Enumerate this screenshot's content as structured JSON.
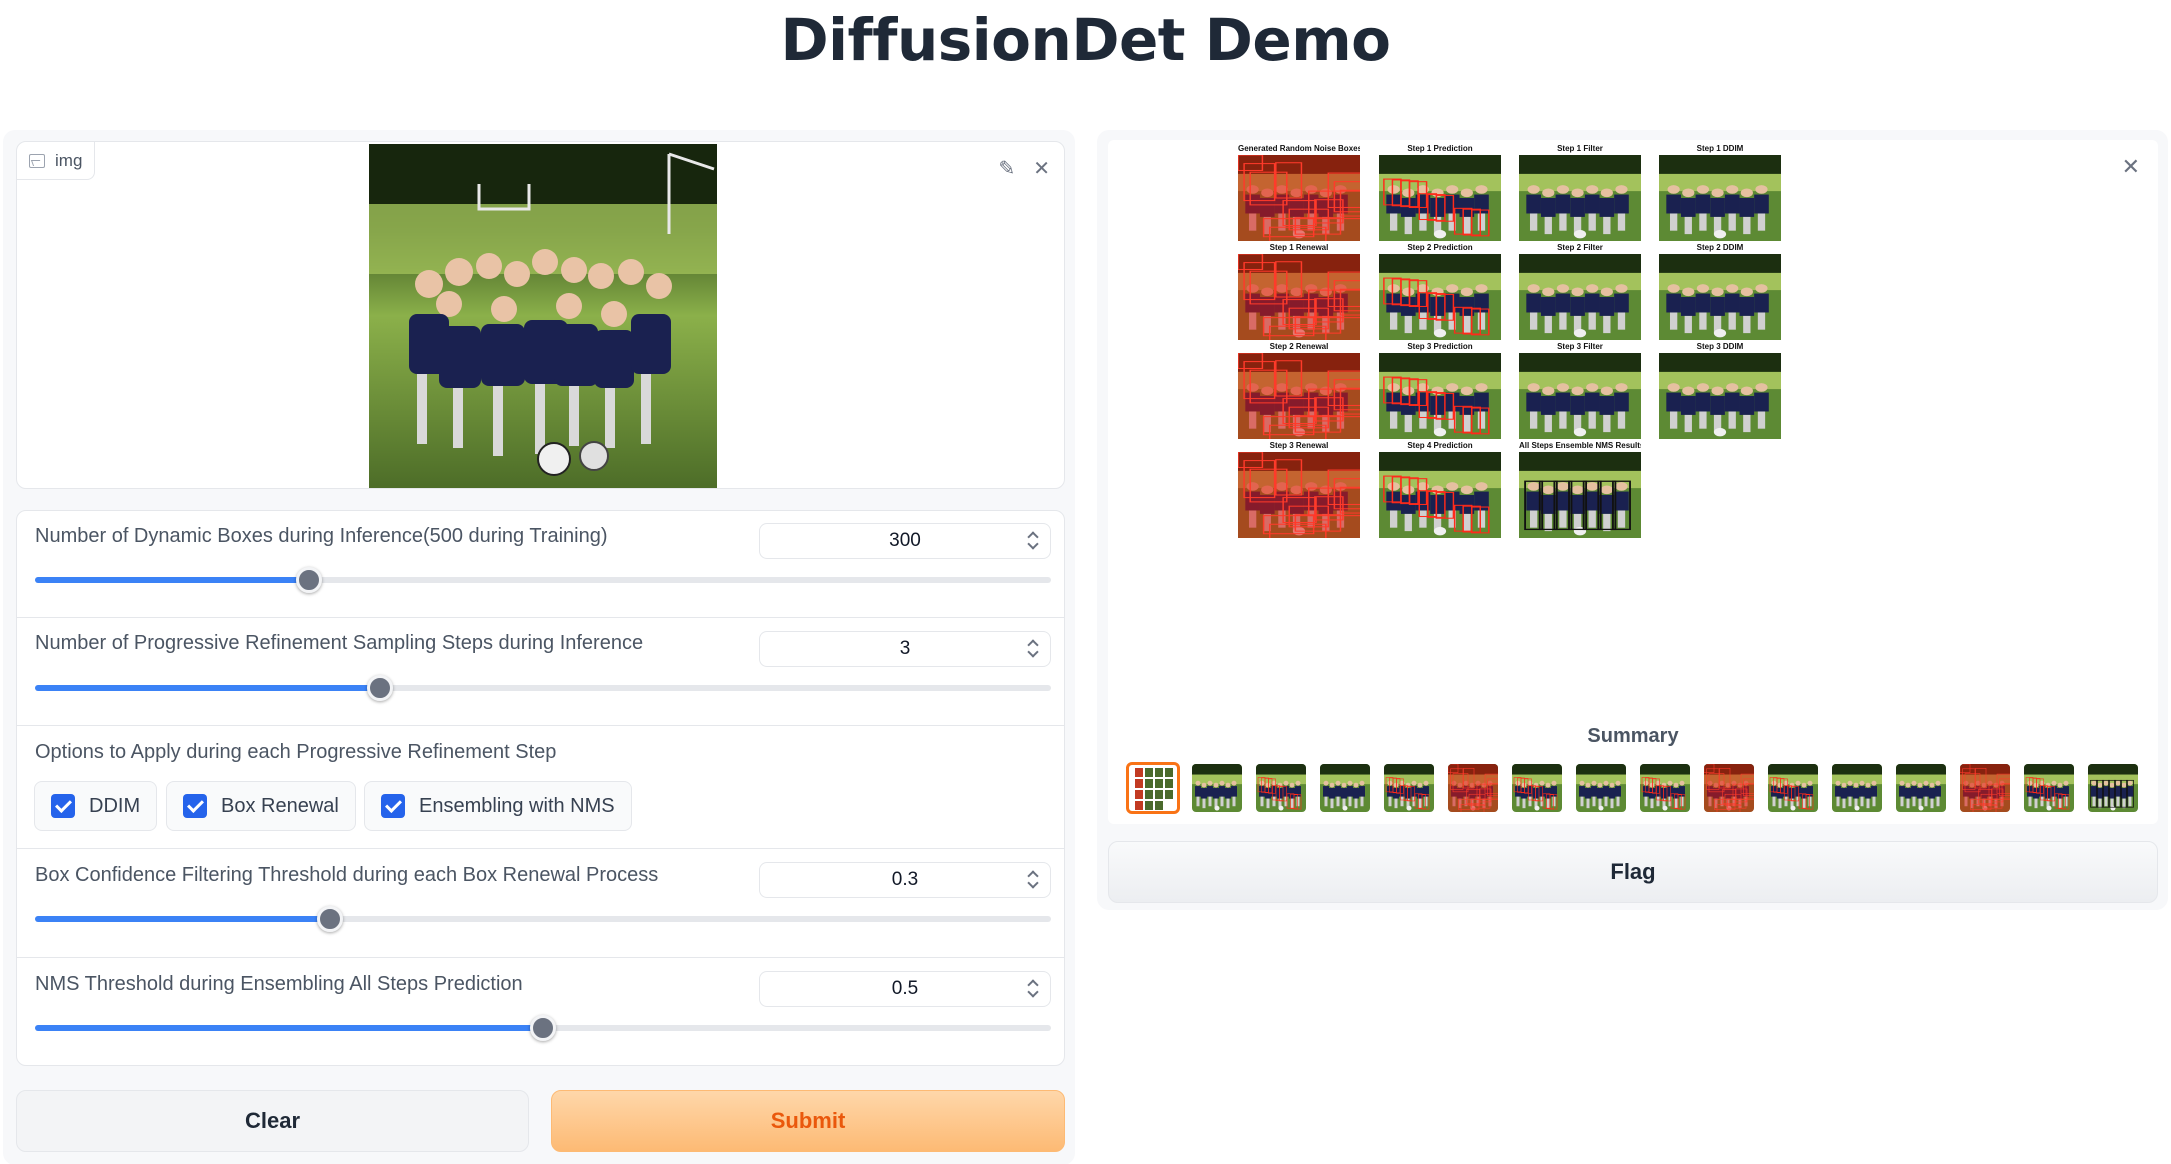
{
  "page": {
    "title": "DiffusionDet Demo"
  },
  "input_image": {
    "label": "img"
  },
  "params": {
    "dynamic_boxes": {
      "label": "Number of Dynamic Boxes during Inference(500 during Training)",
      "value": "300",
      "fraction": 0.27
    },
    "sampling_steps": {
      "label": "Number of Progressive Refinement Sampling Steps during Inference",
      "value": "3",
      "fraction": 0.34
    },
    "options": {
      "label": "Options to Apply during each Progressive Refinement Step",
      "items": [
        "DDIM",
        "Box Renewal",
        "Ensembling with NMS"
      ]
    },
    "box_conf": {
      "label": "Box Confidence Filtering Threshold during each Box Renewal Process",
      "value": "0.3",
      "fraction": 0.29
    },
    "nms": {
      "label": "NMS Threshold during Ensembling All Steps Prediction",
      "value": "0.5",
      "fraction": 0.5
    }
  },
  "buttons": {
    "clear": "Clear",
    "submit": "Submit",
    "flag": "Flag"
  },
  "output": {
    "captions": [
      "Generated Random Noise Boxes",
      "Step 1 Prediction",
      "Step 1 Filter",
      "Step 1 DDIM",
      "Step 1 Renewal",
      "Step 2 Prediction",
      "Step 2 Filter",
      "Step 2 DDIM",
      "Step 2 Renewal",
      "Step 3 Prediction",
      "Step 3 Filter",
      "Step 3 DDIM",
      "Step 3 Renewal",
      "Step 4 Prediction",
      "All Steps Ensemble NMS Results"
    ],
    "summary_label": "Summary",
    "thumbnail_count": 16
  },
  "icons": {
    "image": "image-icon",
    "edit": "pencil-icon",
    "close": "close-icon"
  },
  "colors": {
    "accent": "#3b82f6",
    "submit": "#fdba74",
    "selected_thumb": "#f97316"
  }
}
